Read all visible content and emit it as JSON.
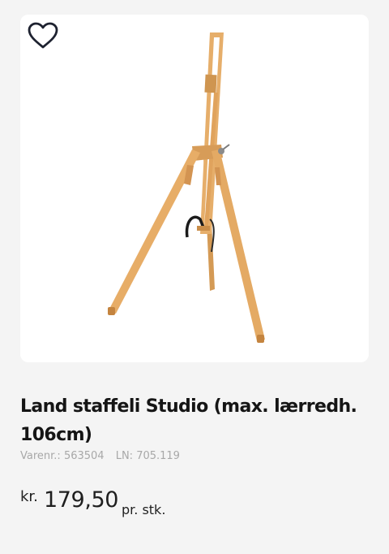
{
  "product": {
    "favorite_icon": "heart-outline-icon",
    "image_alt": "Land staffeli Studio",
    "title": "Land staffeli Studio (max. lærredh. 106cm)",
    "item_number": "Varenr.: 563504",
    "ln_number": "LN: 705.119",
    "price": {
      "currency": "kr.",
      "amount": "179,50",
      "unit": "pr. stk."
    }
  },
  "colors": {
    "background": "#f4f4f4",
    "image_background": "#ffffff",
    "heart_stroke": "#1e2230",
    "wood": "#e2a965"
  }
}
